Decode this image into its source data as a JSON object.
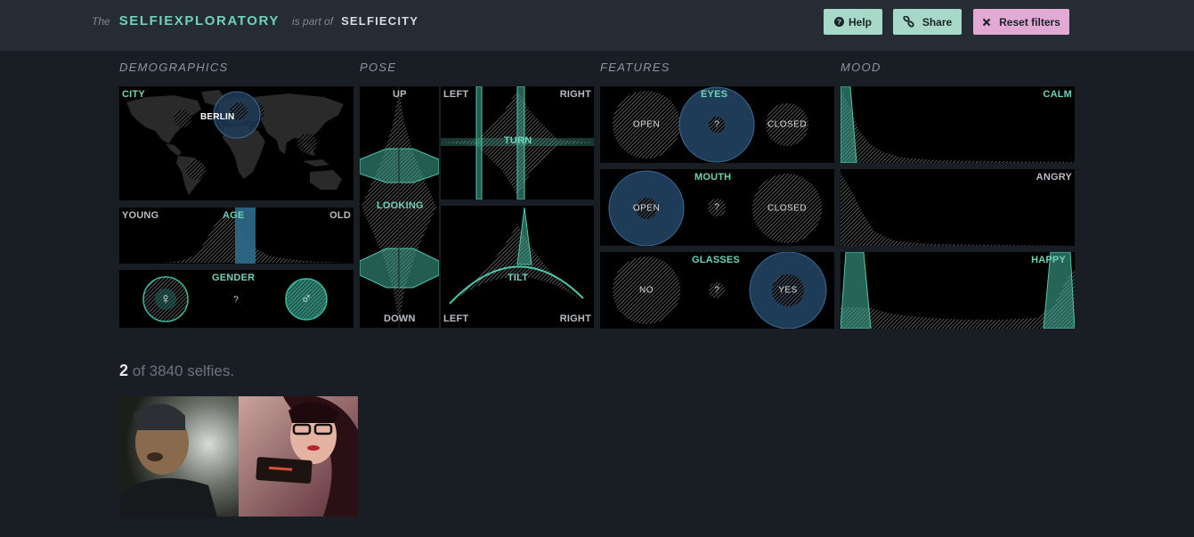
{
  "header": {
    "the": "The",
    "app_name": "SELFIEXPLORATORY",
    "is_part_of": "is part of",
    "parent": "SELFIECITY",
    "buttons": {
      "help": "Help",
      "share": "Share",
      "reset": "Reset filters"
    }
  },
  "sections": {
    "demographics": "DEMOGRAPHICS",
    "pose": "POSE",
    "features": "FEATURES",
    "mood": "MOOD"
  },
  "demographics": {
    "city": {
      "label": "CITY",
      "selected": "BERLIN"
    },
    "age": {
      "label": "AGE",
      "left": "YOUNG",
      "right": "OLD"
    },
    "gender": {
      "label": "GENDER",
      "female": "♀",
      "male": "♂",
      "unknown": "?"
    }
  },
  "pose": {
    "looking": {
      "top": "UP",
      "label": "LOOKING",
      "bottom": "DOWN"
    },
    "turn": {
      "left": "LEFT",
      "label": "TURN",
      "right": "RIGHT"
    },
    "tilt": {
      "label": "TILT",
      "left": "LEFT",
      "right": "RIGHT"
    }
  },
  "features": {
    "eyes": {
      "label": "EYES",
      "a": "OPEN",
      "q": "?",
      "b": "CLOSED"
    },
    "mouth": {
      "label": "MOUTH",
      "a": "OPEN",
      "q": "?",
      "b": "CLOSED"
    },
    "glasses": {
      "label": "GLASSES",
      "a": "NO",
      "q": "?",
      "b": "YES"
    }
  },
  "mood": {
    "calm": "CALM",
    "angry": "ANGRY",
    "happy": "HAPPY"
  },
  "results": {
    "count": "2",
    "rest": "of 3840 selfies."
  },
  "colors": {
    "accent": "#6fd2b9",
    "selected_fill": "#1e3b57",
    "reset": "#e1a9d4",
    "header_bg": "#262c33",
    "page_bg": "#191d24"
  }
}
